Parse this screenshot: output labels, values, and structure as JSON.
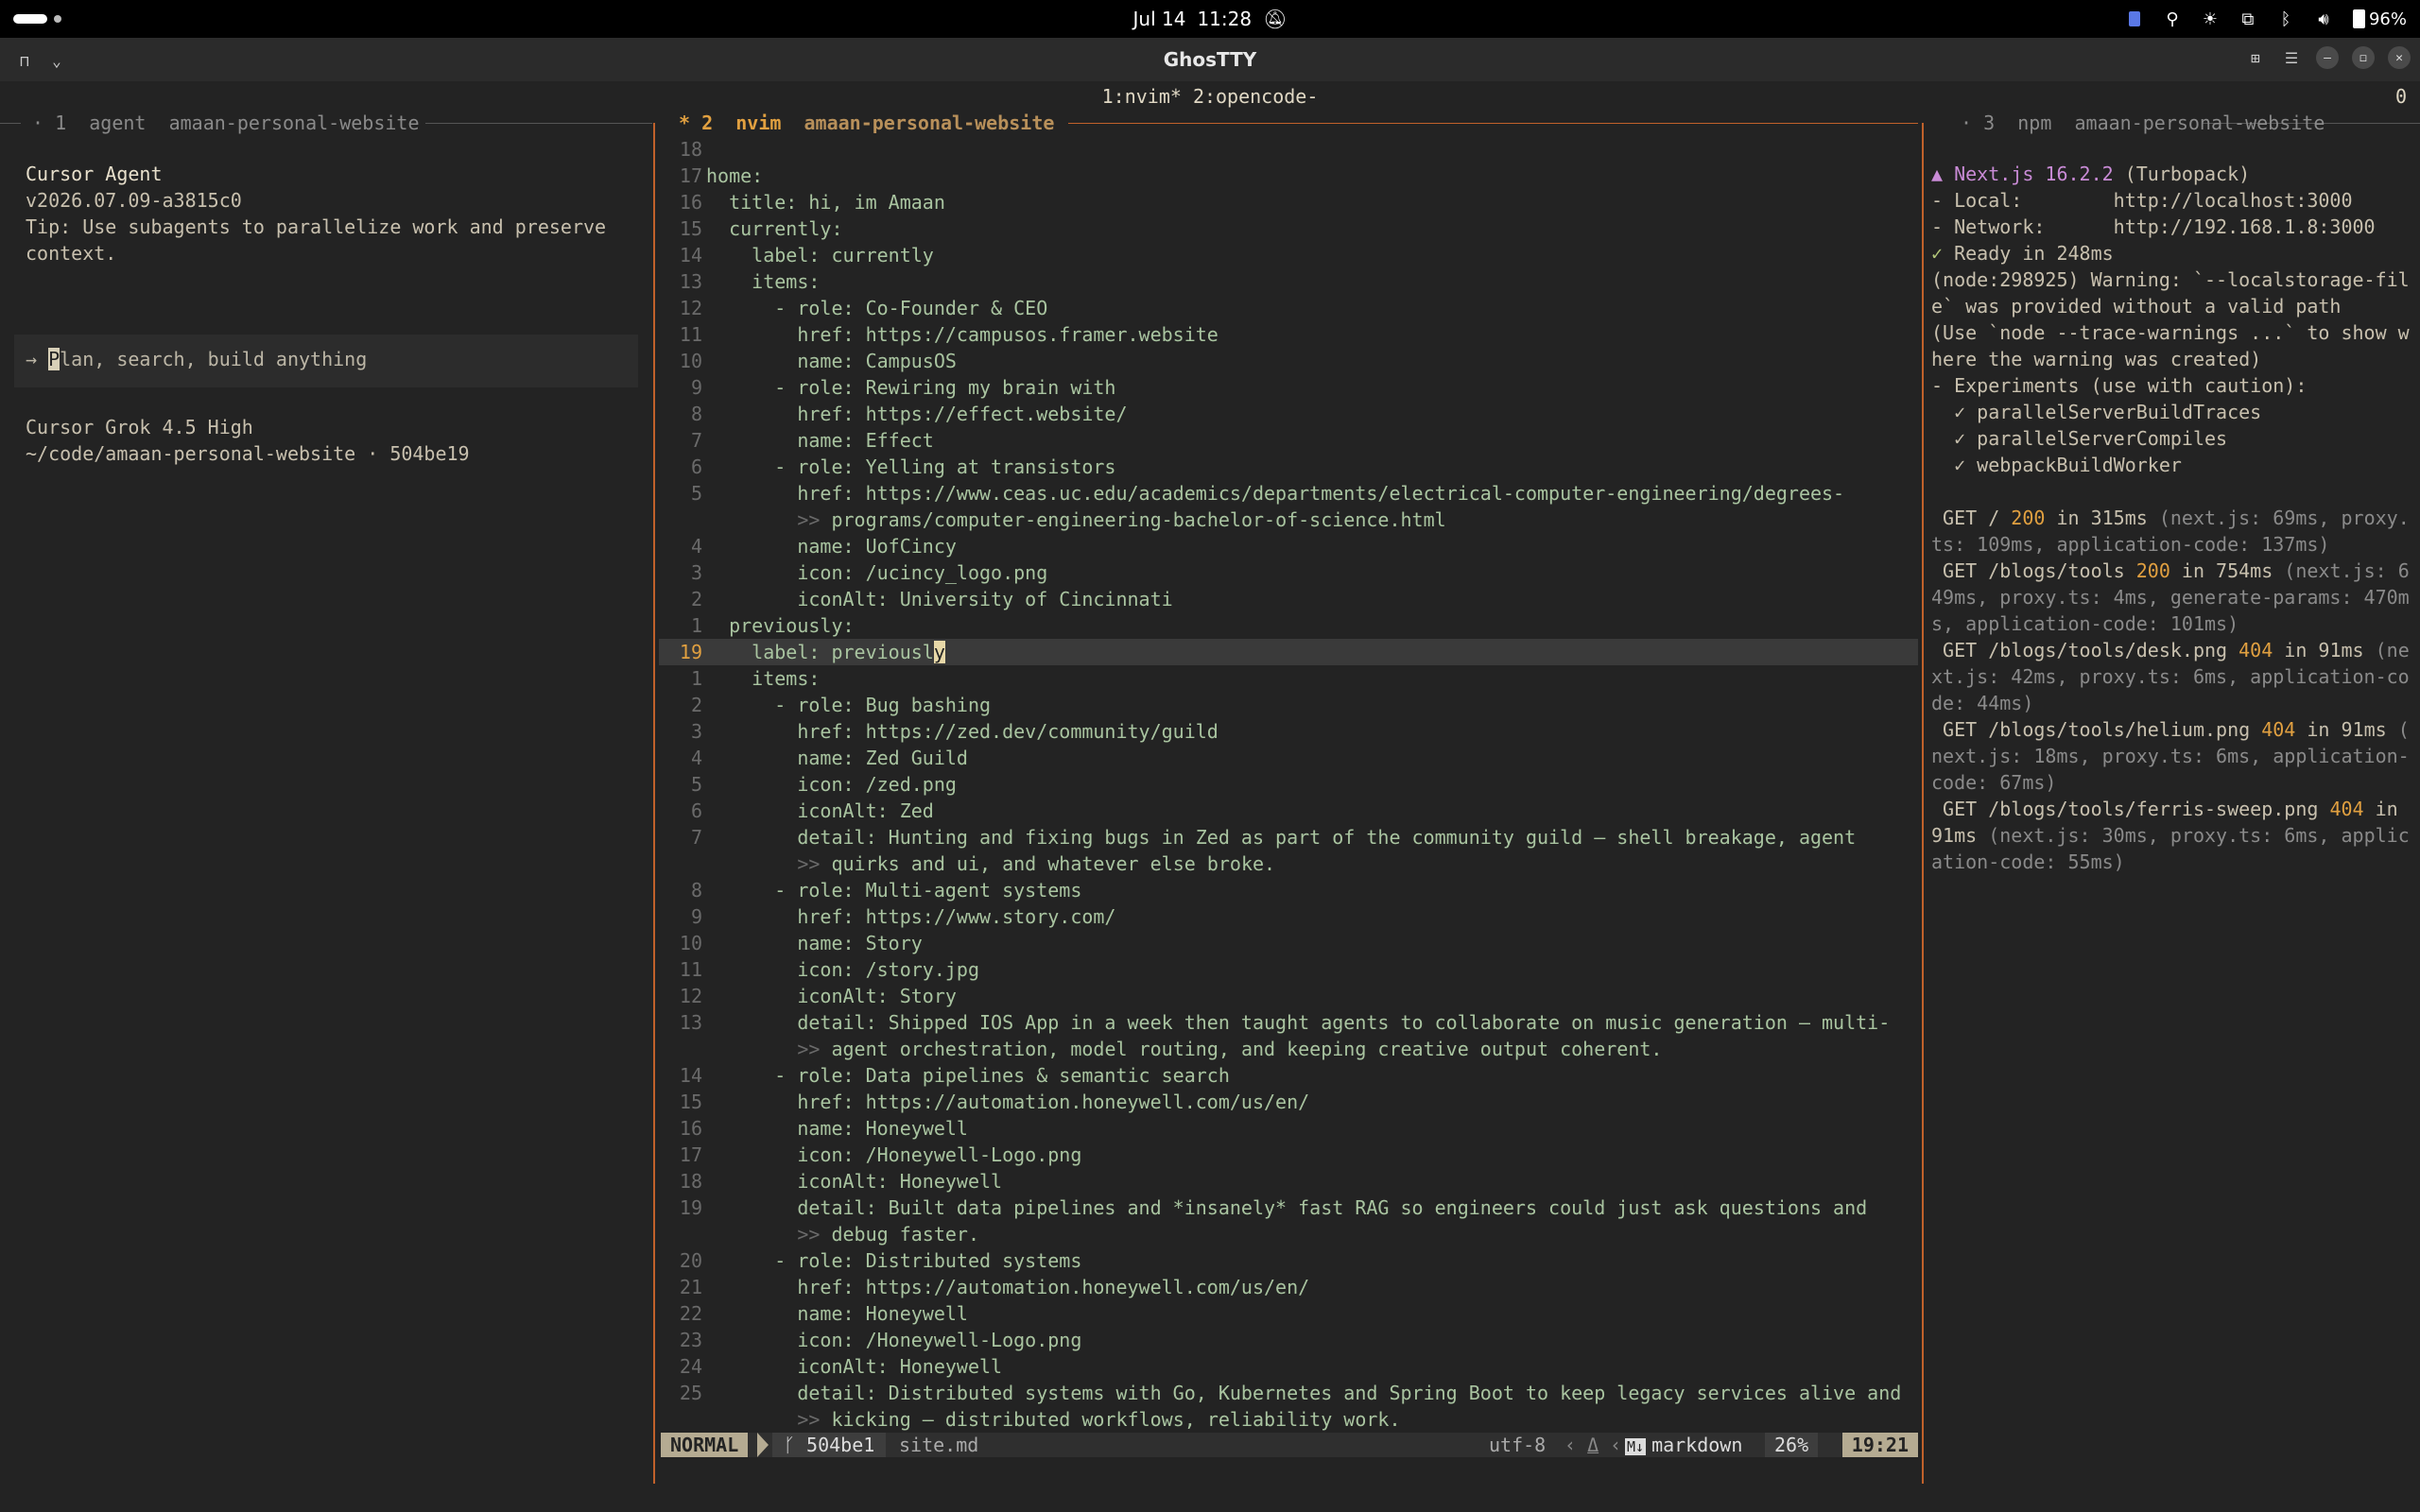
{
  "system_bar": {
    "date": "Jul 14",
    "time": "11:28",
    "battery": "96%"
  },
  "window": {
    "title": "GhosTTY"
  },
  "tmux": {
    "windows": "1:nvim* 2:opencode-",
    "right_num": "0"
  },
  "panes": {
    "left": {
      "index": "1",
      "cmd": "agent",
      "dir": "amaan-personal-website"
    },
    "middle": {
      "marker": "*",
      "index": "2",
      "cmd": "nvim",
      "dir": "amaan-personal-website"
    },
    "right": {
      "index": "3",
      "cmd": "npm",
      "dir": "amaan-personal-website"
    }
  },
  "agent": {
    "name": "Cursor Agent",
    "version": "v2026.07.09-a3815c0",
    "tip_line1": "Tip: Use subagents to parallelize work and preserve",
    "tip_line2": "context.",
    "prompt_arrow": "→",
    "prompt_first": "P",
    "prompt_rest": "lan, search, build anything",
    "model": "Cursor Grok 4.5 High",
    "path": "~/code/amaan-personal-website · 504be19"
  },
  "editor": {
    "lines": [
      {
        "n": "18",
        "t": ""
      },
      {
        "n": "17",
        "t": "home:"
      },
      {
        "n": "16",
        "t": "  title: hi, im Amaan"
      },
      {
        "n": "15",
        "t": "  currently:"
      },
      {
        "n": "14",
        "t": "    label: currently"
      },
      {
        "n": "13",
        "t": "    items:"
      },
      {
        "n": "12",
        "t": "      - role: Co-Founder & CEO"
      },
      {
        "n": "11",
        "t": "        href: https://campusos.framer.website"
      },
      {
        "n": "10",
        "t": "        name: CampusOS"
      },
      {
        "n": "9",
        "t": "      - role: Rewiring my brain with"
      },
      {
        "n": "8",
        "t": "        href: https://effect.website/"
      },
      {
        "n": "7",
        "t": "        name: Effect"
      },
      {
        "n": "6",
        "t": "      - role: Yelling at transistors"
      },
      {
        "n": "5",
        "t": "        href: https://www.ceas.uc.edu/academics/departments/electrical-computer-engineering/degrees-"
      },
      {
        "n": "",
        "t": "           programs/computer-engineering-bachelor-of-science.html",
        "wrap": true
      },
      {
        "n": "4",
        "t": "        name: UofCincy"
      },
      {
        "n": "3",
        "t": "        icon: /ucincy_logo.png"
      },
      {
        "n": "2",
        "t": "        iconAlt: University of Cincinnati"
      },
      {
        "n": "1",
        "t": "  previously:"
      },
      {
        "n": "19",
        "t": "    label: previousl",
        "cur": true,
        "curch": "y"
      },
      {
        "n": "1",
        "t": "    items:"
      },
      {
        "n": "2",
        "t": "      - role: Bug bashing"
      },
      {
        "n": "3",
        "t": "        href: https://zed.dev/community/guild"
      },
      {
        "n": "4",
        "t": "        name: Zed Guild"
      },
      {
        "n": "5",
        "t": "        icon: /zed.png"
      },
      {
        "n": "6",
        "t": "        iconAlt: Zed"
      },
      {
        "n": "7",
        "t": "        detail: Hunting and fixing bugs in Zed as part of the community guild — shell breakage, agent"
      },
      {
        "n": "",
        "t": "           quirks and ui, and whatever else broke.",
        "wrap": true
      },
      {
        "n": "8",
        "t": "      - role: Multi-agent systems"
      },
      {
        "n": "9",
        "t": "        href: https://www.story.com/"
      },
      {
        "n": "10",
        "t": "        name: Story"
      },
      {
        "n": "11",
        "t": "        icon: /story.jpg"
      },
      {
        "n": "12",
        "t": "        iconAlt: Story"
      },
      {
        "n": "13",
        "t": "        detail: Shipped IOS App in a week then taught agents to collaborate on music generation — multi-"
      },
      {
        "n": "",
        "t": "           agent orchestration, model routing, and keeping creative output coherent.",
        "wrap": true
      },
      {
        "n": "14",
        "t": "      - role: Data pipelines & semantic search"
      },
      {
        "n": "15",
        "t": "        href: https://automation.honeywell.com/us/en/"
      },
      {
        "n": "16",
        "t": "        name: Honeywell"
      },
      {
        "n": "17",
        "t": "        icon: /Honeywell-Logo.png"
      },
      {
        "n": "18",
        "t": "        iconAlt: Honeywell"
      },
      {
        "n": "19",
        "t": "        detail: Built data pipelines and *insanely* fast RAG so engineers could just ask questions and"
      },
      {
        "n": "",
        "t": "           debug faster.",
        "wrap": true
      },
      {
        "n": "20",
        "t": "      - role: Distributed systems"
      },
      {
        "n": "21",
        "t": "        href: https://automation.honeywell.com/us/en/"
      },
      {
        "n": "22",
        "t": "        name: Honeywell"
      },
      {
        "n": "23",
        "t": "        icon: /Honeywell-Logo.png"
      },
      {
        "n": "24",
        "t": "        iconAlt: Honeywell"
      },
      {
        "n": "25",
        "t": "        detail: Distributed systems with Go, Kubernetes and Spring Boot to keep legacy services alive and"
      },
      {
        "n": "",
        "t": "           kicking — distributed workflows, reliability work.",
        "wrap": true
      }
    ],
    "wrap_marker": ">>"
  },
  "statusline": {
    "mode": "NORMAL",
    "branch": "504be1",
    "file": "site.md",
    "encoding": "utf-8",
    "filetype": "markdown",
    "percent": "26%",
    "position": "19:21"
  },
  "server": {
    "lines": [
      {
        "segs": [
          {
            "c": "purple",
            "t": "▲ Next.js 16.2.2"
          },
          {
            "c": "",
            "t": " (Turbopack)"
          }
        ]
      },
      {
        "segs": [
          {
            "c": "",
            "t": "- Local:        http://localhost:3000"
          }
        ]
      },
      {
        "segs": [
          {
            "c": "",
            "t": "- Network:      http://192.168.1.8:3000"
          }
        ]
      },
      {
        "segs": [
          {
            "c": "green",
            "t": "✓"
          },
          {
            "c": "",
            "t": " Ready in 248ms"
          }
        ]
      },
      {
        "segs": [
          {
            "c": "",
            "t": "(node:298925) Warning: `--localstorage-fil"
          }
        ]
      },
      {
        "segs": [
          {
            "c": "",
            "t": "e` was provided without a valid path"
          }
        ]
      },
      {
        "segs": [
          {
            "c": "",
            "t": "(Use `node --trace-warnings ...` to show w"
          }
        ]
      },
      {
        "segs": [
          {
            "c": "",
            "t": "here the warning was created)"
          }
        ]
      },
      {
        "segs": [
          {
            "c": "",
            "t": "- Experiments (use with caution):"
          }
        ]
      },
      {
        "segs": [
          {
            "c": "",
            "t": "  ✓ parallelServerBuildTraces"
          }
        ]
      },
      {
        "segs": [
          {
            "c": "",
            "t": "  ✓ parallelServerCompiles"
          }
        ]
      },
      {
        "segs": [
          {
            "c": "",
            "t": "  ✓ webpackBuildWorker"
          }
        ]
      },
      {
        "segs": [
          {
            "c": "",
            "t": ""
          }
        ]
      },
      {
        "segs": [
          {
            "c": "",
            "t": " GET / "
          },
          {
            "c": "orange",
            "t": "200"
          },
          {
            "c": "",
            "t": " in 315ms "
          },
          {
            "c": "gray",
            "t": "(next.js: 69ms, proxy."
          }
        ]
      },
      {
        "segs": [
          {
            "c": "gray",
            "t": "ts: 109ms, application-code: 137ms)"
          }
        ]
      },
      {
        "segs": [
          {
            "c": "",
            "t": " GET /blogs/tools "
          },
          {
            "c": "orange",
            "t": "200"
          },
          {
            "c": "",
            "t": " in 754ms "
          },
          {
            "c": "gray",
            "t": "(next.js: 6"
          }
        ]
      },
      {
        "segs": [
          {
            "c": "gray",
            "t": "49ms, proxy.ts: 4ms, generate-params: 470m"
          }
        ]
      },
      {
        "segs": [
          {
            "c": "gray",
            "t": "s, application-code: 101ms)"
          }
        ]
      },
      {
        "segs": [
          {
            "c": "",
            "t": " GET /blogs/tools/desk.png "
          },
          {
            "c": "orange",
            "t": "404"
          },
          {
            "c": "",
            "t": " in 91ms "
          },
          {
            "c": "gray",
            "t": "(ne"
          }
        ]
      },
      {
        "segs": [
          {
            "c": "gray",
            "t": "xt.js: 42ms, proxy.ts: 6ms, application-co"
          }
        ]
      },
      {
        "segs": [
          {
            "c": "gray",
            "t": "de: 44ms)"
          }
        ]
      },
      {
        "segs": [
          {
            "c": "",
            "t": " GET /blogs/tools/helium.png "
          },
          {
            "c": "orange",
            "t": "404"
          },
          {
            "c": "",
            "t": " in 91ms "
          },
          {
            "c": "gray",
            "t": "("
          }
        ]
      },
      {
        "segs": [
          {
            "c": "gray",
            "t": "next.js: 18ms, proxy.ts: 6ms, application-"
          }
        ]
      },
      {
        "segs": [
          {
            "c": "gray",
            "t": "code: 67ms)"
          }
        ]
      },
      {
        "segs": [
          {
            "c": "",
            "t": " GET /blogs/tools/ferris-sweep.png "
          },
          {
            "c": "orange",
            "t": "404"
          },
          {
            "c": "",
            "t": " in"
          }
        ]
      },
      {
        "segs": [
          {
            "c": "",
            "t": "91ms "
          },
          {
            "c": "gray",
            "t": "(next.js: 30ms, proxy.ts: 6ms, applic"
          }
        ]
      },
      {
        "segs": [
          {
            "c": "gray",
            "t": "ation-code: 55ms)"
          }
        ]
      }
    ]
  },
  "colors": {
    "accent_orange": "#e1a040",
    "border_orange": "#c0612b",
    "code_green": "#a9c4a0",
    "next_purple": "#c98bd6"
  }
}
